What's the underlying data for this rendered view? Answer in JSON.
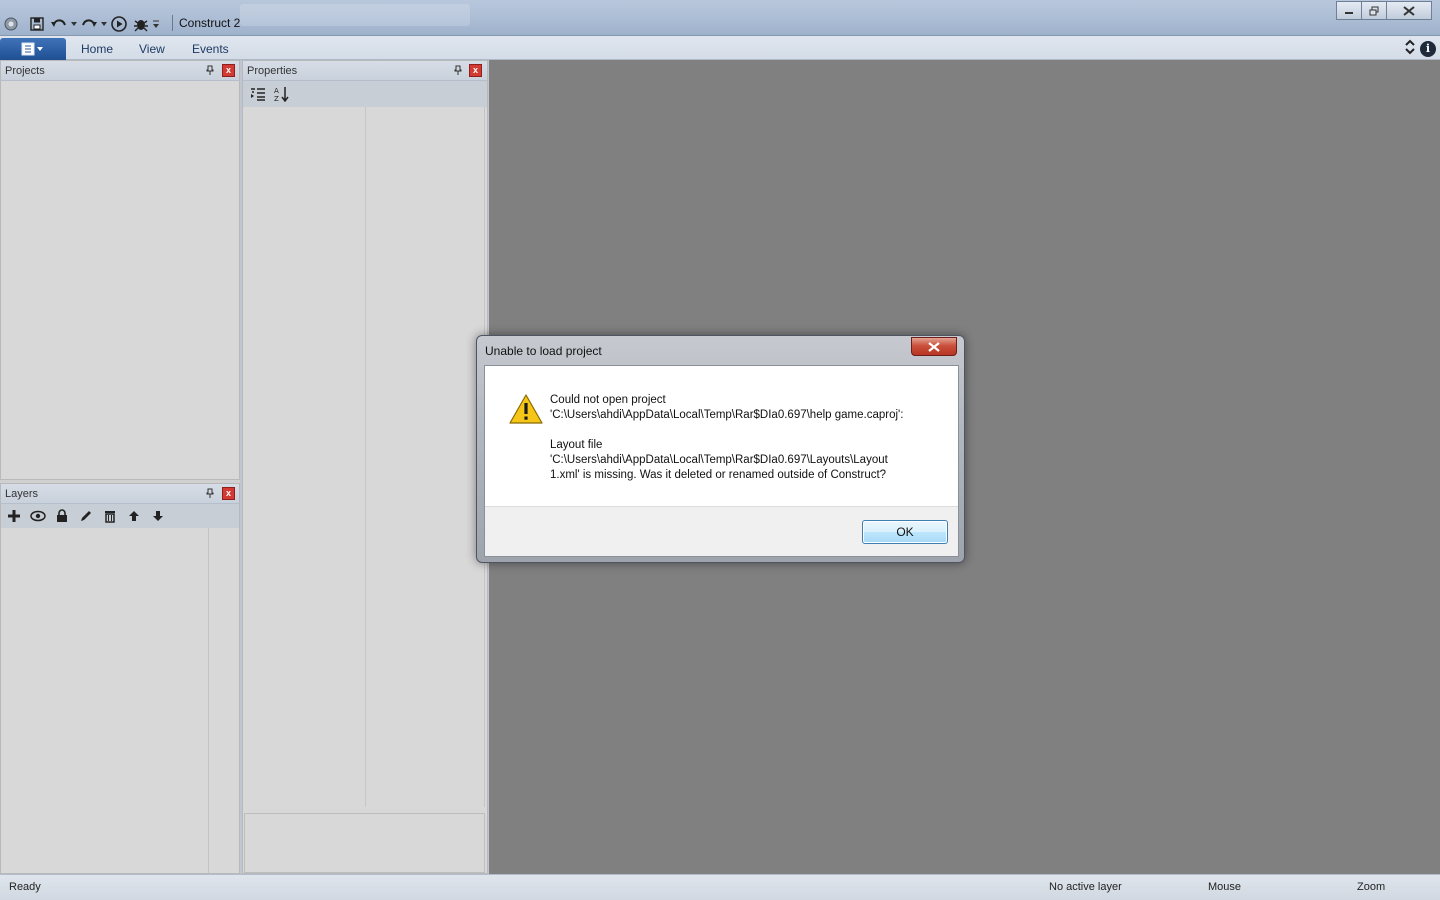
{
  "app": {
    "title": "Construct 2"
  },
  "ribbon": {
    "tabs": [
      "Home",
      "View",
      "Events"
    ]
  },
  "panels": {
    "projects": {
      "title": "Projects"
    },
    "properties": {
      "title": "Properties"
    },
    "layers": {
      "title": "Layers"
    }
  },
  "status": {
    "ready": "Ready",
    "layer": "No active layer",
    "mouse": "Mouse",
    "zoom": "Zoom"
  },
  "dialog": {
    "title": "Unable to load project",
    "message": "Could not open project\n'C:\\Users\\ahdi\\AppData\\Local\\Temp\\Rar$DIa0.697\\help game.caproj':\n\nLayout file\n'C:\\Users\\ahdi\\AppData\\Local\\Temp\\Rar$DIa0.697\\Layouts\\Layout\n1.xml' is missing.  Was it deleted or renamed outside of Construct?",
    "ok_label": "OK",
    "close_glyph": "x"
  },
  "colors": {
    "workspace": "#808080",
    "accent": "#1f4f93",
    "close_red": "#d43a34"
  }
}
